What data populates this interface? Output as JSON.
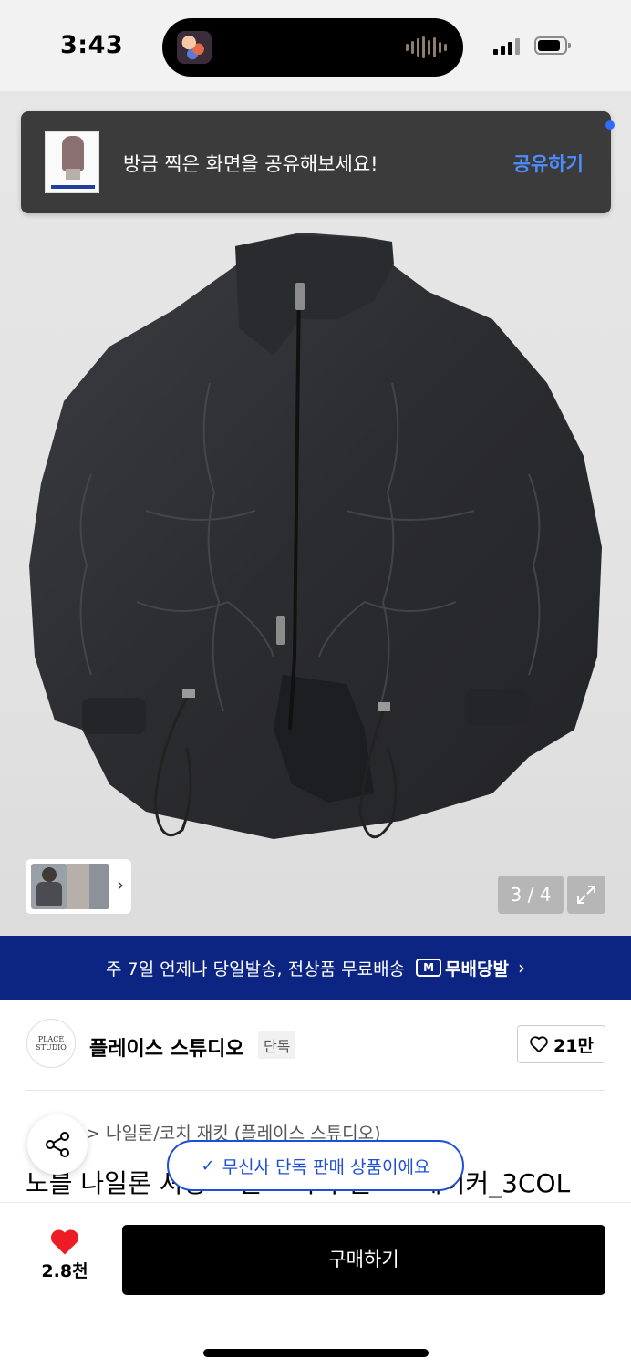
{
  "status_bar": {
    "time": "3:43"
  },
  "share_toast": {
    "message": "방금 찍은 화면을 공유해보세요!",
    "action": "공유하기"
  },
  "gallery": {
    "counter": "3 / 4",
    "current_index": 3,
    "total": 4
  },
  "delivery_banner": {
    "text": "주 7일 언제나 당일발송, 전상품 무료배송",
    "logo_text": "무배당발",
    "logo_icon": "M"
  },
  "brand": {
    "logo_text": "PLACE STUDIO",
    "name": "플레이스 스튜디오",
    "badge": "단독",
    "like_count": "21만"
  },
  "product": {
    "breadcrumb_sep": ">",
    "breadcrumb": "나일론/코치 재킷 (플레이스 스튜디오)",
    "title": "노블 나일론 셔링 스탠드 카라 윈드브레이커_3COL"
  },
  "exclusive_pill": {
    "text": "무신사 단독 판매 상품이에요"
  },
  "bottom_bar": {
    "favorite_count": "2.8천",
    "buy_label": "구매하기"
  },
  "colors": {
    "banner_bg": "#0c2482",
    "accent_blue": "#1e4fd6",
    "toast_action": "#4c8dff",
    "heart_red": "#ee1c25"
  }
}
